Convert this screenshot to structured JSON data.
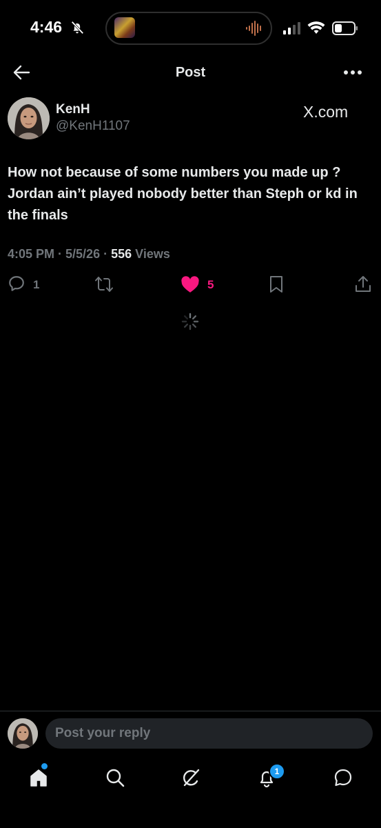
{
  "status_bar": {
    "time": "4:46"
  },
  "nav": {
    "title": "Post"
  },
  "author": {
    "name": "KenH",
    "handle": "@KenH1107",
    "source": "X.com"
  },
  "post": {
    "text": "How not because of some numbers you made up ? Jordan ain’t played nobody better than Steph or kd in the finals",
    "time": "4:05 PM",
    "date": "5/5/26",
    "views_count": "556",
    "views_label": "Views",
    "separator": " · "
  },
  "actions": {
    "replies": "1",
    "likes": "5"
  },
  "reply": {
    "placeholder": "Post your reply"
  },
  "tabs": {
    "notifications_badge": "1"
  },
  "colors": {
    "accent": "#1d9bf0",
    "like": "#f91880",
    "muted": "#71767b",
    "text": "#e7e9ea"
  },
  "icons": [
    "back-arrow-icon",
    "more-icon",
    "reply-icon",
    "repost-icon",
    "heart-icon",
    "bookmark-icon",
    "share-icon",
    "home-icon",
    "search-icon",
    "grok-icon",
    "bell-icon",
    "messages-icon"
  ]
}
